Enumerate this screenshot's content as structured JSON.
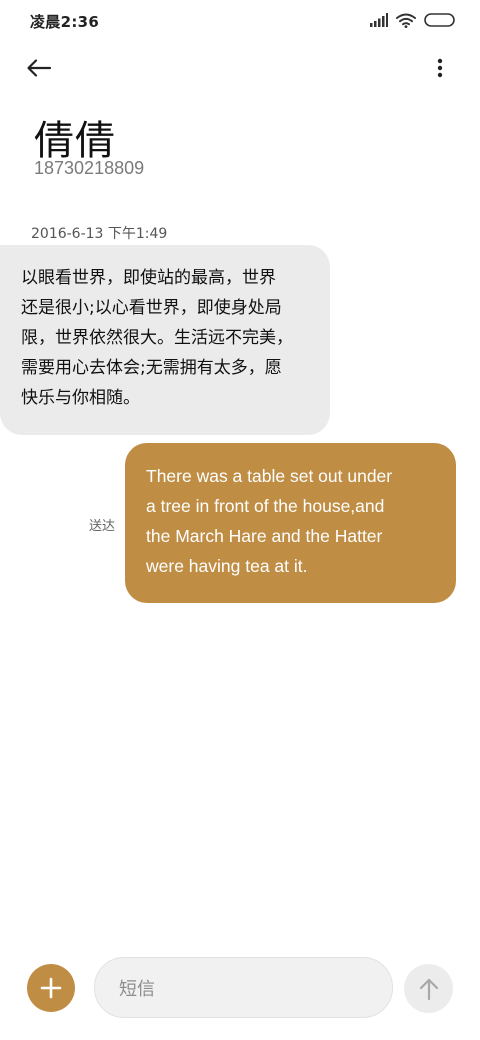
{
  "status_bar": {
    "time": "凌晨2:36",
    "icons": [
      "signal-icon",
      "wifi-icon",
      "battery-icon"
    ]
  },
  "top_bar": {
    "back_icon": "back-arrow-icon",
    "more_icon": "more-vertical-icon"
  },
  "contact": {
    "name": "倩倩",
    "number": "18730218809"
  },
  "conversation": {
    "timestamp": "2016-6-13 下午1:49",
    "messages": [
      {
        "direction": "incoming",
        "lines": [
          "以眼看世界，即使站的最高，世界",
          "还是很小;以心看世界，即使身处局",
          "限，世界依然很大。生活远不完美，",
          "需要用心去体会;无需拥有太多，愿",
          "快乐与你相随。"
        ]
      },
      {
        "direction": "outgoing",
        "status": "送达",
        "lines": [
          "There was a table set out under",
          "a tree in front of the house,and",
          "the March Hare and the Hatter",
          "were having tea at it."
        ]
      }
    ]
  },
  "composer": {
    "add_icon": "plus-icon",
    "placeholder": "短信",
    "send_icon": "arrow-up-icon"
  },
  "colors": {
    "accent": "#c08d45",
    "incoming_bubble": "#ebebeb",
    "background": "#ffffff"
  }
}
